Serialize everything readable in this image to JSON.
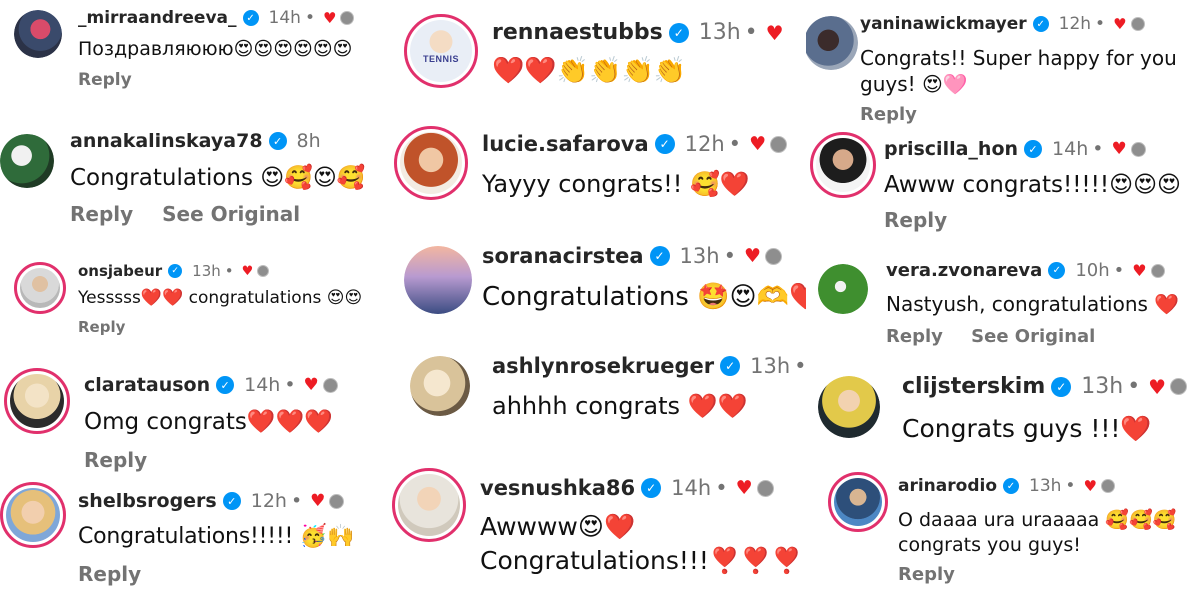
{
  "actions": {
    "reply": "Reply",
    "see_original": "See Original"
  },
  "comments": [
    {
      "user": "_mirraandreeva_",
      "time": "14h",
      "text": "Поздравляююю",
      "emoji": "😍😍😍😍😍😍"
    },
    {
      "user": "annakalinskaya78",
      "time": "8h",
      "text": "Congratulations ",
      "emoji": "😍🥰😍🥰"
    },
    {
      "user": "onsjabeur",
      "time": "13h",
      "text": "Yesssss",
      "emoji": "❤️❤️",
      "text2": " congratulations ",
      "emoji2": "😍😍"
    },
    {
      "user": "claratauson",
      "time": "14h",
      "text": "Omg congrats",
      "emoji": "❤️❤️❤️"
    },
    {
      "user": "shelbsrogers",
      "time": "12h",
      "text": "Congratulations!!!!! ",
      "emoji": "🥳🙌"
    },
    {
      "user": "rennaestubbs",
      "time": "13h",
      "avatar_text": "TENNIS",
      "emoji": "❤️❤️👏👏👏👏"
    },
    {
      "user": "lucie.safarova",
      "time": "12h",
      "text": "Yayyy congrats!! ",
      "emoji": "🥰❤️"
    },
    {
      "user": "soranacirstea",
      "time": "13h",
      "text": "Congratulations ",
      "emoji": "🤩😍🫶❤️"
    },
    {
      "user": "ashlynrosekrueger",
      "time": "13h",
      "text": "ahhhh congrats ",
      "emoji": "❤️❤️"
    },
    {
      "user": "vesnushka86",
      "time": "14h",
      "text": "Awwww",
      "emoji": "😍❤️",
      "line2": "Congratulations!!!",
      "emoji2": "❣️❣️❣️"
    },
    {
      "user": "yaninawickmayer",
      "time": "12h",
      "text": "Congrats!! Super happy for you",
      "line2": "guys! ",
      "emoji2": "😍🩷"
    },
    {
      "user": "priscilla_hon",
      "time": "14h",
      "text": "Awww congrats!!!!!",
      "emoji": "😍😍😍"
    },
    {
      "user": "vera.zvonareva",
      "time": "10h",
      "text": "Nastyush, congratulations ",
      "emoji": "❤️"
    },
    {
      "user": "clijsterskim",
      "time": "13h",
      "text": "Congrats guys !!!",
      "emoji": "❤️"
    },
    {
      "user": "arinarodio",
      "time": "13h",
      "text": "O daaaa ura uraaaaa ",
      "emoji": "🥰🥰🥰",
      "line2": "congrats you guys!"
    }
  ]
}
